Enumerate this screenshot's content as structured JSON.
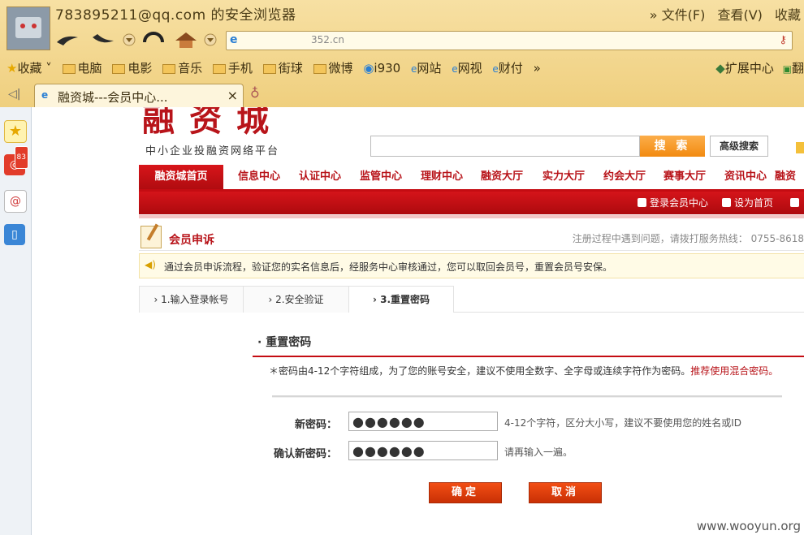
{
  "browser": {
    "window_title": "783895211@qq.com 的安全浏览器",
    "menus": [
      "» 文件(F)",
      "查看(V)",
      "收藏"
    ],
    "address": "352.cn",
    "bookmarks": [
      {
        "label": "收藏",
        "icon": "star-icon"
      },
      {
        "label": "电脑",
        "icon": "folder-icon"
      },
      {
        "label": "电影",
        "icon": "folder-icon"
      },
      {
        "label": "音乐",
        "icon": "folder-icon"
      },
      {
        "label": "手机",
        "icon": "folder-icon"
      },
      {
        "label": "街球",
        "icon": "folder-icon"
      },
      {
        "label": "微博",
        "icon": "folder-icon"
      },
      {
        "label": "i930",
        "icon": "video-icon"
      },
      {
        "label": "网站",
        "icon": "ie-icon"
      },
      {
        "label": "网视",
        "icon": "ie-icon"
      },
      {
        "label": "财付",
        "icon": "ie-icon"
      },
      {
        "label": "»",
        "icon": ""
      }
    ],
    "extension_label": "扩展中心",
    "translate_label": "翻",
    "tab_title": "融资城---会员中心...",
    "tab_close": "×",
    "weibo_badge": "83"
  },
  "site": {
    "logo": "融资城",
    "slogan": "中小企业投融资网络平台",
    "search_button": "搜 索",
    "advanced_search": "高级搜索",
    "nav": [
      "融资城首页",
      "信息中心",
      "认证中心",
      "监管中心",
      "理财中心",
      "融资大厅",
      "实力大厅",
      "约会大厅",
      "赛事大厅",
      "资讯中心",
      "融资"
    ],
    "sub_links": [
      "登录会员中心",
      "设为首页"
    ]
  },
  "section": {
    "title": "会员申诉",
    "hotline": "注册过程中遇到问题，请拨打服务热线： 0755-8618",
    "notice": "通过会员申诉流程，验证您的实名信息后，经服务中心审核通过，您可以取回会员号，重置会员号安保。"
  },
  "steps": [
    {
      "label": "1.输入登录帐号",
      "current": false
    },
    {
      "label": "2.安全验证",
      "current": false
    },
    {
      "label": "3.重置密码",
      "current": true
    }
  ],
  "form": {
    "title": "重置密码",
    "hint": "＊密码由4-12个字符组成，为了您的账号安全，建议不使用全数字、全字母或连续字符作为密码。",
    "hint_emphasis": "推荐使用混合密码。",
    "new_password_label": "新密码：",
    "new_password_value": "●●●●●●",
    "new_password_tip": "4-12个字符，区分大小写，建议不要使用您的姓名或ID",
    "confirm_label": "确认新密码：",
    "confirm_value": "●●●●●●",
    "confirm_tip": "请再输入一遍。",
    "ok_button": "确定",
    "cancel_button": "取消"
  },
  "watermark": "www.wooyun.org",
  "colors": {
    "brand_red": "#b8141a",
    "button_orange": "#e8400c",
    "chrome": "#f4d78e"
  }
}
